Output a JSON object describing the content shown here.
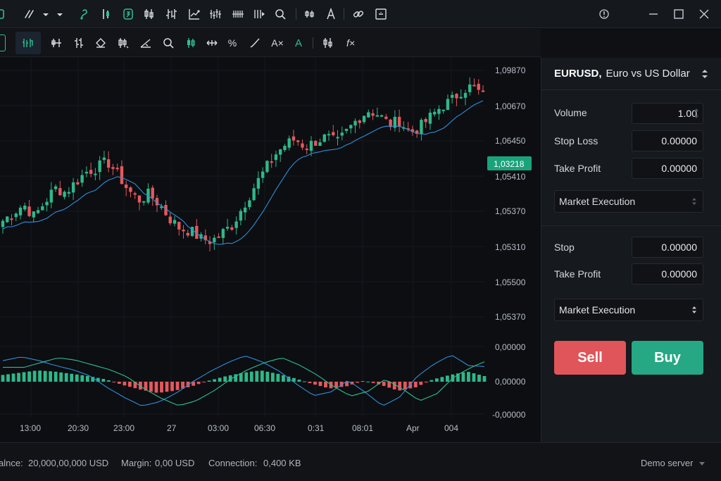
{
  "theme": {
    "bull": "#2eb88a",
    "bear": "#e5585c",
    "ma": "#2e8fd6",
    "signal": "#2fbf8f",
    "price_tag": "#1aa37a",
    "buy": "#26a884",
    "sell": "#e0555a"
  },
  "titlebar": {
    "icons": [
      "drawing-lines-icon",
      "dropdown-arrow-icon",
      "dropdown-arrow-icon",
      "curve-tool-icon",
      "candle-bars-icon",
      "snapshot-icon",
      "candles-icon",
      "bars-icon",
      "trend-chart-icon",
      "multi-bars-icon",
      "grid-bars-icon",
      "zoom-icon",
      "compare-icon",
      "text-tool-icon",
      "link-icon",
      "frame-icon",
      "info-icon",
      "minimize-icon",
      "maximize-icon",
      "close-icon"
    ]
  },
  "toolbar": {
    "icons": [
      "chart-type-icon",
      "bar-chart-icon",
      "crosshair-bars-icon",
      "ohlc-icon",
      "layer-icon",
      "candle-settings-icon",
      "trendline-icon",
      "zoom-icon",
      "candle-icon",
      "move-icon",
      "percent-icon",
      "line-icon",
      "text-clear-icon",
      "text-color-icon",
      "indicator-icon",
      "function-icon"
    ],
    "percent_label": "%",
    "text_clear_label": "A×",
    "text_color_label": "A",
    "function_label": "f×"
  },
  "chart": {
    "price_labels": [
      "1,09870",
      "1,00670",
      "1,06450",
      "1,05410",
      "1,05370",
      "1,05310",
      "1,05500",
      "1,05370"
    ],
    "current_price": "1,03218",
    "macd_labels": [
      "0,00000",
      "0,00000",
      "-0,00000"
    ],
    "time_labels": [
      "13:00",
      "20:30",
      "23:00",
      "27",
      "03:00",
      "06:30",
      "0:31",
      "08:01",
      "Apr",
      "004"
    ]
  },
  "chart_data": {
    "type": "candlestick",
    "main_price_axis_ticks": [
      "1,09870",
      "1,00670",
      "1,06450",
      "1,05410",
      "1,05370",
      "1,05310",
      "1,05500",
      "1,05370"
    ],
    "last_price": "1,03218",
    "x_tick_labels": [
      "13:00",
      "20:30",
      "23:00",
      "27",
      "03:00",
      "06:30",
      "0:31",
      "08:01",
      "Apr",
      "004"
    ],
    "candles_close_trend": [
      0.34,
      0.38,
      0.42,
      0.36,
      0.43,
      0.5,
      0.48,
      0.53,
      0.58,
      0.6,
      0.63,
      0.57,
      0.49,
      0.44,
      0.47,
      0.42,
      0.35,
      0.3,
      0.29,
      0.25,
      0.24,
      0.28,
      0.32,
      0.41,
      0.5,
      0.58,
      0.66,
      0.71,
      0.74,
      0.7,
      0.73,
      0.75,
      0.72,
      0.78,
      0.84,
      0.88,
      0.86,
      0.81,
      0.83,
      0.77,
      0.8,
      0.85,
      0.9,
      0.93,
      0.98,
      1.0,
      0.95
    ],
    "moving_average": true,
    "macd_panel": {
      "axis_ticks": [
        "0,00000",
        "0,00000",
        "-0,00000"
      ],
      "histogram": [
        0.6,
        0.8,
        1.0,
        0.9,
        0.7,
        0.5,
        0.2,
        -0.3,
        -0.7,
        -1.0,
        -0.8,
        -0.4,
        0.1,
        0.5,
        0.8,
        1.0,
        0.7,
        0.3,
        -0.2,
        -0.6,
        -0.4,
        0.1,
        -0.3,
        -0.8,
        -0.5,
        0.2,
        0.6,
        0.9,
        0.5
      ]
    },
    "grid": true
  },
  "order_panel": {
    "symbol_code": "EURUSD,",
    "symbol_name": "Euro vs US Dollar",
    "volume_label": "Volume",
    "volume_value": "1.00",
    "stop_loss_label": "Stop Loss",
    "stop_loss_value": "0.00000",
    "take_profit_label": "Take Profit",
    "take_profit_value": "0.00000",
    "execution_1": "Market Execution",
    "stop_label": "Stop",
    "stop_value": "0.00000",
    "take_profit_2_label": "Take Profit",
    "take_profit_2_value": "0.00000",
    "execution_2": "Market Execution",
    "sell_label": "Sell",
    "buy_label": "Buy"
  },
  "status": {
    "balance_label": "alnce:",
    "balance_value": "20,000,00,000 USD",
    "margin_label": "Margin:",
    "margin_value": "0,00 USD",
    "connection_label": "Connection:",
    "connection_value": "0,400 KB",
    "server_label": "Demo server"
  }
}
